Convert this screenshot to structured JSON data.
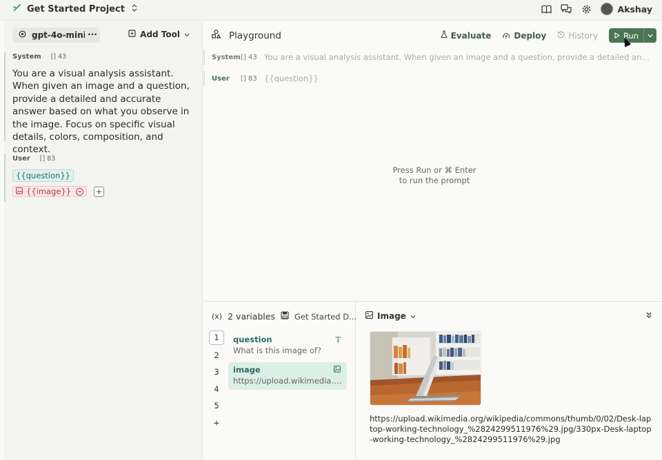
{
  "topbar": {
    "project_name": "Get Started Project",
    "user_name": "Akshay",
    "icons": [
      "book-icon",
      "chat-bubbles-icon",
      "gear-icon",
      "avatar"
    ]
  },
  "left_panel": {
    "model_name": "gpt-4o-mini",
    "more_label": "···",
    "add_tool_label": "Add Tool",
    "system": {
      "role": "System",
      "tokens": "[] 43",
      "text": "You are a visual analysis assistant. When given an image and a question, provide a detailed and accurate answer based on what you observe in the image. Focus on specific visual details, colors, composition, and context."
    },
    "user": {
      "role": "User",
      "tokens": "[] 83",
      "question_var": "{{question}}",
      "image_var": "{{image}}",
      "add_label": "+"
    }
  },
  "playground": {
    "title": "Playground",
    "actions": {
      "evaluate": "Evaluate",
      "deploy": "Deploy",
      "history": "History",
      "run": "Run"
    },
    "messages": {
      "system": {
        "role": "System",
        "tokens": "[] 43",
        "preview": "You are a visual analysis assistant. When given an image and a question, provide a detailed and accurate answer based on what you observe in the image. Focus on specific visual details, colors, composition, and context."
      },
      "user": {
        "role": "User",
        "tokens": "[] 83",
        "preview": "{{question}}"
      }
    },
    "empty_hint_line1": "Press Run or ⌘ Enter",
    "empty_hint_line2": "to run the prompt"
  },
  "variables": {
    "icon_label": "(x)",
    "count_label": "2 variables",
    "dataset_label": "Get Started D...",
    "row_numbers": [
      "1",
      "2",
      "3",
      "4",
      "5",
      "+"
    ],
    "items": [
      {
        "name": "question",
        "value": "What is this image of?",
        "type_icon": "T"
      },
      {
        "name": "image",
        "value": "https://upload.wikimedia.org/wikipedia/commons/thumb/0/02/Desk-laptop-working-technology_%2824299511976%29.jpg/330px-Desk-laptop-working-technology_%2824299511976%29.jpg",
        "type_icon": "image-icon"
      }
    ]
  },
  "preview": {
    "type_label": "Image",
    "url": "https://upload.wikimedia.org/wikipedia/commons/thumb/0/02/Desk-laptop-working-technology_%2824299511976%29.jpg/330px-Desk-laptop-working-technology_%2824299511976%29.jpg"
  },
  "colors": {
    "accent_green": "#4b7654",
    "var_teal": "#1f6f66",
    "var_red": "#b33a3a"
  }
}
